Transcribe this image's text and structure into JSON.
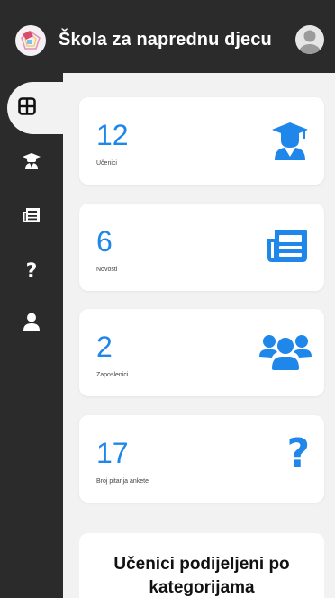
{
  "header": {
    "title": "Škola za naprednu djecu"
  },
  "sidebar": {
    "items": [
      {
        "icon": "dashboard-grid-icon"
      },
      {
        "icon": "graduate-icon"
      },
      {
        "icon": "newspaper-icon"
      },
      {
        "icon": "question-icon",
        "glyph": "?"
      },
      {
        "icon": "user-icon"
      }
    ]
  },
  "cards": [
    {
      "value": "12",
      "label": "Učenici",
      "icon": "graduate-icon"
    },
    {
      "value": "6",
      "label": "Novosti",
      "icon": "newspaper-icon"
    },
    {
      "value": "2",
      "label": "Zaposlenici",
      "icon": "users-icon"
    },
    {
      "value": "17",
      "label": "Broj pitanja ankete",
      "icon": "question-icon",
      "glyph": "?"
    }
  ],
  "chart_section": {
    "title": "Učenici podijeljeni po kategorijama"
  },
  "colors": {
    "accent": "#1f86ea",
    "sidebar": "#2b2b2b",
    "background": "#f2f2f2"
  }
}
